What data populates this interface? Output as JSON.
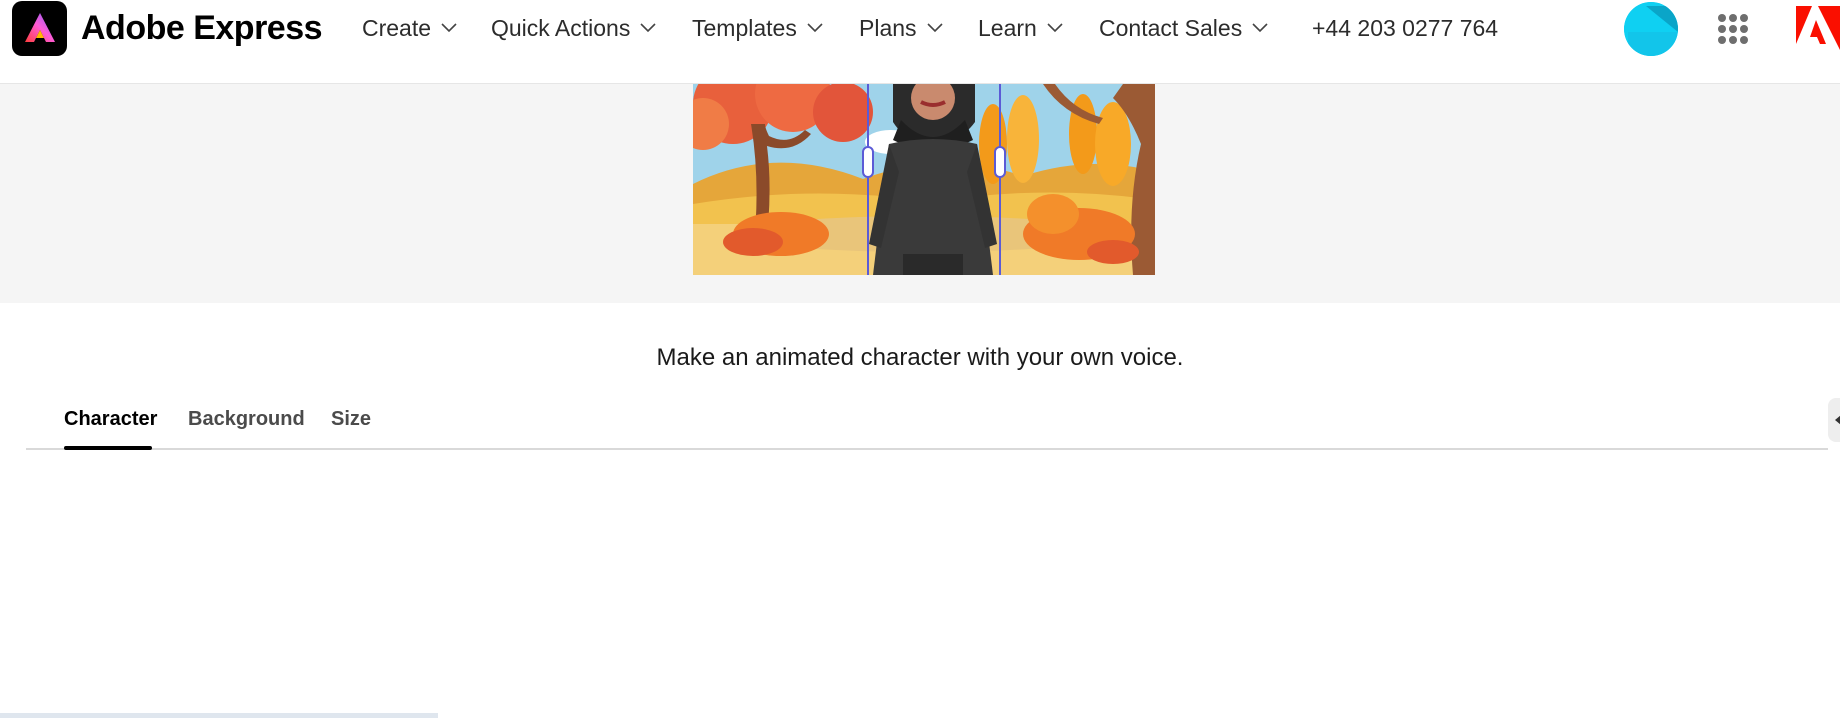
{
  "header": {
    "brand_name": "Adobe Express",
    "nav": [
      {
        "label": "Create"
      },
      {
        "label": "Quick Actions"
      },
      {
        "label": "Templates"
      },
      {
        "label": "Plans"
      },
      {
        "label": "Learn"
      },
      {
        "label": "Contact Sales"
      }
    ],
    "phone": "+44 203 0277 764",
    "icons": {
      "brand": "adobe-express-logo-icon",
      "avatar": "user-avatar",
      "apps": "app-grid-icon",
      "adobe": "adobe-logo-icon"
    }
  },
  "preview": {
    "scene": "animated character in autumn park"
  },
  "main": {
    "caption": "Make an animated character with your own voice.",
    "tabs": [
      {
        "label": "Character",
        "active": true
      },
      {
        "label": "Background",
        "active": false
      },
      {
        "label": "Size",
        "active": false
      }
    ]
  },
  "colors": {
    "accent_handle": "#5b5bd6",
    "avatar": "#0fd0f2",
    "adobe_red": "#fa0f00"
  }
}
